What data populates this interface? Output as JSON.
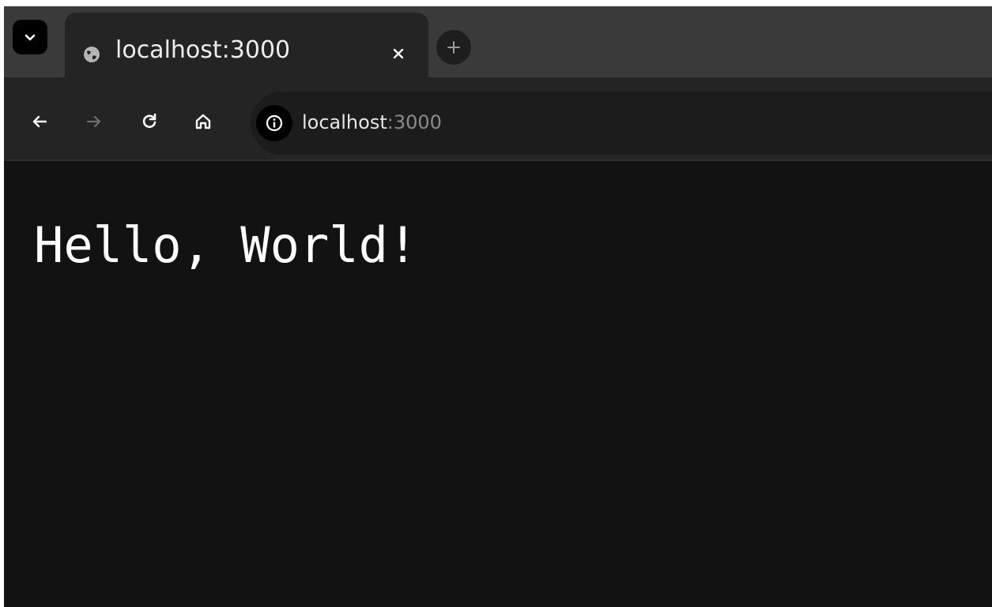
{
  "browser": {
    "tab": {
      "title": "localhost:3000",
      "favicon": "globe-icon"
    },
    "tab_list_icon": "chevron-down-icon",
    "close_icon": "close-icon",
    "new_tab_icon": "plus-icon",
    "toolbar": {
      "back_icon": "arrow-left-icon",
      "forward_icon": "arrow-right-icon",
      "reload_icon": "reload-icon",
      "home_icon": "home-icon"
    },
    "address_bar": {
      "site_info_icon": "info-icon",
      "host": "localhost",
      "port": ":3000"
    }
  },
  "page": {
    "text": "Hello, World!"
  },
  "colors": {
    "page_background": "#121212",
    "toolbar_background": "#242424",
    "tabstrip_background": "#3a3a3a",
    "text": "#ffffff",
    "port_text": "#8a8a8a"
  }
}
